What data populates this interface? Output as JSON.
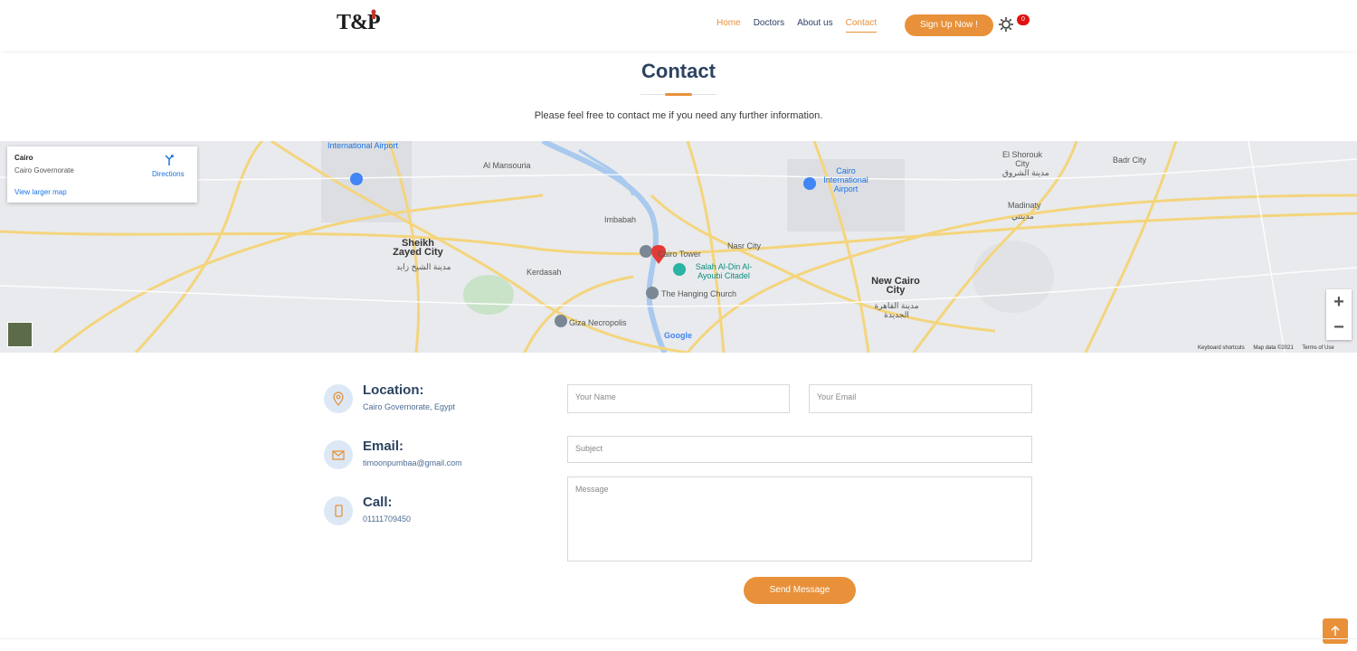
{
  "header": {
    "logo": "T&P",
    "nav": [
      {
        "label": "Home"
      },
      {
        "label": "Doctors"
      },
      {
        "label": "About us"
      },
      {
        "label": "Contact"
      }
    ],
    "signup_label": "Sign Up Now !",
    "notification_count": "0"
  },
  "page": {
    "title": "Contact",
    "subtitle": "Please feel free to contact me if you need any further information."
  },
  "map": {
    "card_title": "Cairo",
    "card_subtitle": "Cairo Governorate",
    "card_link": "View larger map",
    "directions_label": "Directions",
    "labels": {
      "intl_airport": "International Airport",
      "cairo_airport": "Cairo International Airport",
      "sheikh_zayed": "Sheikh Zayed City",
      "sheikh_zayed_ar": "مدينة الشيخ زايد",
      "cairo_tower": "Cairo Tower",
      "salah": "Salah Al-Din Al-Ayoubi Citadel",
      "hanging_church": "The Hanging Church",
      "giza": "Giza Necropolis",
      "nasr_city": "Nasr City",
      "new_cairo": "New Cairo City",
      "new_cairo_ar": "مدينة القاهرة الجديدة",
      "madinaty": "Madinaty",
      "madinaty_ar": "مدينتي",
      "el_shorouk": "El Shorouk City",
      "el_shorouk_ar": "مدينة الشروق",
      "imbabah": "Imbabah",
      "kerdasah": "Kerdasah",
      "al_mansouria": "Al Mansouria",
      "badr_city": "Badr City",
      "google": "Google"
    },
    "footer": [
      "Keyboard shortcuts",
      "Map data ©2021",
      "Terms of Use"
    ],
    "zoom_in": "+",
    "zoom_out": "−"
  },
  "contact": {
    "location_title": "Location:",
    "location_value": "Cairo Governorate, Egypt",
    "email_title": "Email:",
    "email_value": "timoonpumbaa@gmail.com",
    "call_title": "Call:",
    "call_value": "01111709450"
  },
  "form": {
    "name_placeholder": "Your Name",
    "email_placeholder": "Your Email",
    "subject_placeholder": "Subject",
    "message_placeholder": "Message",
    "send_label": "Send Message"
  },
  "colors": {
    "accent": "#e8913a",
    "heading": "#2b4360",
    "badge": "#e21212"
  }
}
